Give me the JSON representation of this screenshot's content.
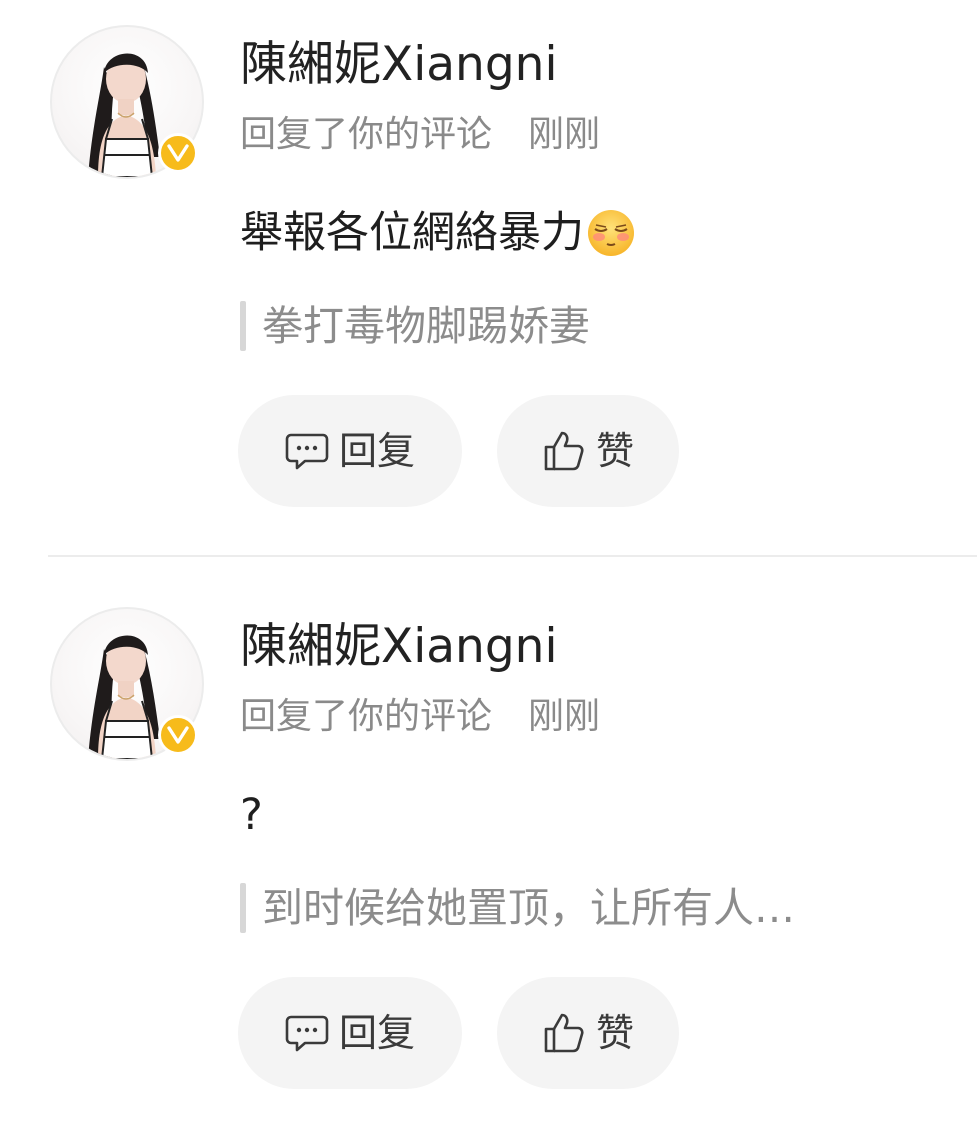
{
  "notifications": [
    {
      "username": "陳緗妮Xiangni",
      "action": "回复了你的评论",
      "time": "刚刚",
      "comment": "舉報各位網絡暴力",
      "comment_emoji": "shy-face-emoji",
      "quoted": "拳打毒物脚踢娇妻",
      "reply_label": "回复",
      "like_label": "赞",
      "verified_badge": "V"
    },
    {
      "username": "陳緗妮Xiangni",
      "action": "回复了你的评论",
      "time": "刚刚",
      "comment": "?",
      "quoted": "到时候给她置顶，让所有人…",
      "reply_label": "回复",
      "like_label": "赞",
      "verified_badge": "V"
    }
  ],
  "icons": {
    "reply": "comment-bubble-icon",
    "like": "thumbs-up-icon",
    "badge": "verified-v-icon"
  },
  "colors": {
    "badge": "#f7bb1b",
    "button_bg": "#f4f4f4",
    "secondary_text": "#8a8a8a"
  }
}
